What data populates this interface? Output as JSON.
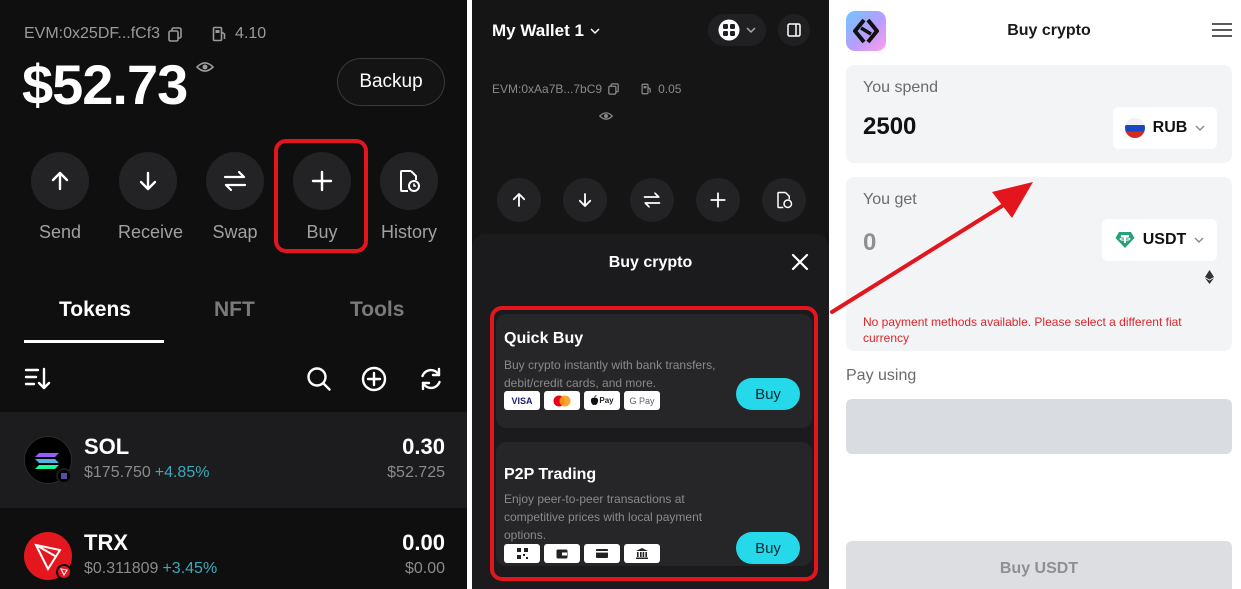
{
  "screen1": {
    "address": "EVM:0x25DF...fCf3",
    "gas_value": "4.10",
    "balance": "$52.73",
    "backup_label": "Backup",
    "actions": [
      {
        "label": "Send",
        "icon": "arrow-up-icon"
      },
      {
        "label": "Receive",
        "icon": "arrow-down-icon"
      },
      {
        "label": "Swap",
        "icon": "swap-icon"
      },
      {
        "label": "Buy",
        "icon": "plus-icon"
      },
      {
        "label": "History",
        "icon": "history-icon"
      }
    ],
    "tabs": [
      "Tokens",
      "NFT",
      "Tools"
    ],
    "tokens": [
      {
        "name": "SOL",
        "price": "$175.750",
        "change": "+4.85%",
        "amount": "0.30",
        "value": "$52.725"
      },
      {
        "name": "TRX",
        "price": "$0.311809",
        "change": "+3.45%",
        "amount": "0.00",
        "value": "$0.00"
      }
    ]
  },
  "screen2": {
    "wallet_name": "My Wallet 1",
    "address": "EVM:0xAa7B...7bC9",
    "gas_value": "0.05",
    "sheet_title": "Buy crypto",
    "options": [
      {
        "title": "Quick Buy",
        "description": "Buy crypto instantly with bank transfers, debit/credit cards, and more.",
        "button": "Buy",
        "payment_methods": [
          "VISA",
          "Mastercard",
          "Apple Pay",
          "G Pay"
        ]
      },
      {
        "title": "P2P Trading",
        "description": "Enjoy peer-to-peer transactions at competitive prices with local payment options.",
        "button": "Buy",
        "payment_methods": [
          "qr-code-icon",
          "wallet-icon",
          "card-icon",
          "bank-icon"
        ]
      }
    ]
  },
  "screen3": {
    "title": "Buy crypto",
    "spend_label": "You spend",
    "spend_value": "2500",
    "spend_currency": "RUB",
    "get_label": "You get",
    "get_value": "0",
    "get_currency": "USDT",
    "error": "No payment methods available. Please select a different fiat currency",
    "pay_using_label": "Pay using",
    "buy_button": "Buy USDT"
  },
  "colors": {
    "highlight_red": "#e3151d",
    "accent_cyan": "#25d8ea",
    "error_red": "#e0242a",
    "positive_change": "#3ea8b8"
  }
}
